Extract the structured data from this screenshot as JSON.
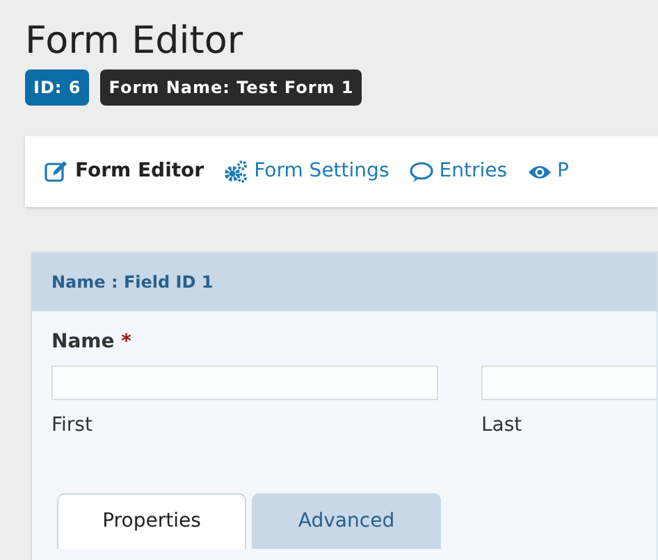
{
  "title": "Form Editor",
  "badges": [
    {
      "text": "ID: 6",
      "kind": "id"
    },
    {
      "text": "Form Name: Test Form 1",
      "kind": "name"
    }
  ],
  "nav": [
    {
      "label": "Form Editor",
      "kind": "edit",
      "selected": true
    },
    {
      "label": "Form Settings",
      "kind": "gears",
      "selected": false
    },
    {
      "label": "Entries",
      "kind": "comment",
      "selected": false
    },
    {
      "label": "P",
      "kind": "eye",
      "selected": false
    }
  ],
  "field_panel": {
    "header": "Name : Field ID 1",
    "label": "Name",
    "required_mark": "*",
    "inputs": [
      {
        "sublabel": "First"
      },
      {
        "sublabel": "Last"
      }
    ],
    "tabs": [
      {
        "label": "Properties",
        "selected": true
      },
      {
        "label": "Advanced",
        "selected": false
      }
    ]
  }
}
